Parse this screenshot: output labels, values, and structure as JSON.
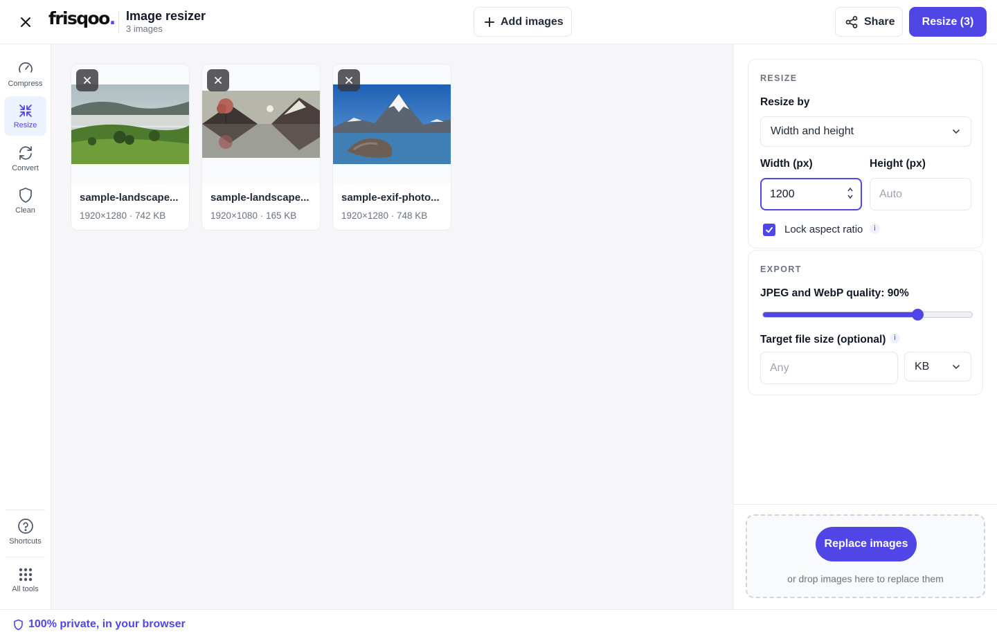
{
  "header": {
    "logo_text": "frisqoo",
    "logo_dot": ".",
    "title": "Image resizer",
    "subtitle": "3 images",
    "add_images_label": "Add images",
    "share_label": "Share",
    "resize_label": "Resize (3)"
  },
  "sidebar": {
    "items": [
      {
        "label": "Compress",
        "icon": "gauge-icon"
      },
      {
        "label": "Resize",
        "icon": "resize-arrows-icon",
        "active": true
      },
      {
        "label": "Convert",
        "icon": "refresh-icon"
      },
      {
        "label": "Clean",
        "icon": "shield-icon"
      }
    ],
    "bottom": [
      {
        "label": "Shortcuts",
        "icon": "question-circle-icon"
      },
      {
        "label": "All tools",
        "icon": "grid-dots-icon"
      }
    ]
  },
  "images": [
    {
      "name": "sample-landscape...",
      "meta": "1920×1280 · 742 KB"
    },
    {
      "name": "sample-landscape...",
      "meta": "1920×1080 · 165 KB"
    },
    {
      "name": "sample-exif-photo...",
      "meta": "1920×1280 · 748 KB"
    }
  ],
  "resize": {
    "section_title": "RESIZE",
    "resize_by_label": "Resize by",
    "resize_by_value": "Width and height",
    "width_label": "Width (px)",
    "width_value": "1200",
    "height_label": "Height (px)",
    "height_placeholder": "Auto",
    "lock_label": "Lock aspect ratio",
    "lock_checked": true,
    "info_glyph": "i"
  },
  "export": {
    "section_title": "EXPORT",
    "quality_label": "JPEG and WebP quality: 90%",
    "quality_value": 90,
    "target_label": "Target file size (optional)",
    "target_placeholder": "Any",
    "unit_value": "KB"
  },
  "drop": {
    "replace_label": "Replace images",
    "hint": "or drop images here to replace them"
  },
  "footer": {
    "privacy_text": "100% private, in your browser"
  },
  "colors": {
    "accent": "#4f46e5",
    "accent_light": "#eef2ff"
  }
}
